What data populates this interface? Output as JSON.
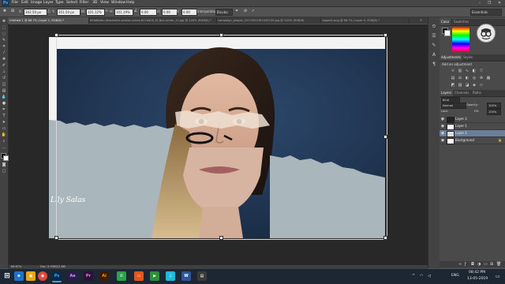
{
  "app": {
    "logo_text": "Ps",
    "menus": [
      "File",
      "Edit",
      "Image",
      "Layer",
      "Type",
      "Select",
      "Filter",
      "3D",
      "View",
      "Window",
      "Help"
    ],
    "window_controls": [
      "–",
      "❐",
      "✕"
    ]
  },
  "options_bar": {
    "x_label": "X:",
    "x_value": "302.50 px",
    "y_label": "Y:",
    "y_value": "351.50 px",
    "w_label": "W:",
    "w_value": "101.12%",
    "h_label": "H:",
    "h_value": "101.19%",
    "angle_value": "0.00",
    "h_skew_label": "H:",
    "h_skew_value": "0.00",
    "v_skew_label": "V:",
    "v_skew_value": "0.00",
    "interpolation_label": "Interpolation:",
    "interpolation_value": "Bicubic",
    "workspace_value": "Essentials"
  },
  "doc_tabs": [
    {
      "label": "Untitled-1 @ 66.7% (Layer 1, RGB/8) *",
      "active": true
    },
    {
      "label": "69fa6bfac-deacedd-b-ocasio-cortez-627a400_M_Nov-under_10.jpg @ 100% (RGB/8) *",
      "active": false
    },
    {
      "label": "campaign_people_20170921W1549743.jpg @ 100% (RGB/8)",
      "active": false
    },
    {
      "label": "ripped2.png @ 66.7% (Layer 0, RGB/8) *",
      "active": false
    }
  ],
  "canvas": {
    "signature_text": "Lily Salas"
  },
  "status_bar": {
    "zoom": "66.67%",
    "doc_info": "Doc: 5.93M/22.8M"
  },
  "panels": {
    "color_tabs": [
      "Color",
      "Swatches"
    ],
    "adjustments_tabs": [
      "Adjustments",
      "Styles"
    ],
    "adjustments_hint": "Add an adjustment",
    "layers_tabs": [
      "Layers",
      "Channels",
      "Paths"
    ],
    "kind_value": "Kind",
    "blend_mode": "Normal",
    "opacity_label": "Opacity:",
    "opacity_value": "100%",
    "lock_label": "Lock:",
    "fill_label": "Fill:",
    "fill_value": "100%",
    "layers": [
      {
        "name": "Layer 2",
        "selected": false
      },
      {
        "name": "Layer 1",
        "selected": false
      },
      {
        "name": "Layer 1",
        "selected": true
      },
      {
        "name": "Background",
        "selected": false
      }
    ]
  },
  "taskbar": {
    "apps": [
      {
        "label": "⊞",
        "color": "#1c2733"
      },
      {
        "label": "e",
        "color": "#1e73c8"
      },
      {
        "label": "▣",
        "color": "#e6a817"
      },
      {
        "label": "◉",
        "color": "#dd4b39"
      },
      {
        "label": "Ps",
        "color": "#0c2a47"
      },
      {
        "label": "Ae",
        "color": "#2a1b4a"
      },
      {
        "label": "Pr",
        "color": "#2a1436"
      },
      {
        "label": "Ai",
        "color": "#3a1c05"
      },
      {
        "label": "✆",
        "color": "#2ba34a"
      },
      {
        "label": "▭",
        "color": "#e0571d"
      },
      {
        "label": "▶",
        "color": "#2c8f3a"
      },
      {
        "label": "♫",
        "color": "#20b8d8"
      },
      {
        "label": "W",
        "color": "#2b579a"
      },
      {
        "label": "▤",
        "color": "#3a3a3a"
      }
    ],
    "language": "ENG",
    "time": "08:42 PM",
    "date": "13-05-2019"
  }
}
